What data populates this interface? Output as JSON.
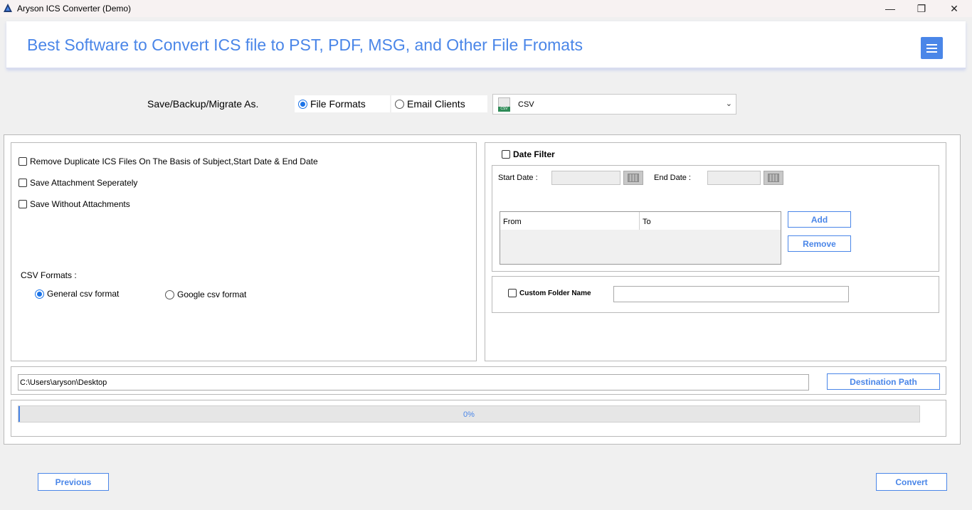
{
  "window": {
    "title": "Aryson ICS Converter (Demo)",
    "minimize_glyph": "—",
    "maximize_glyph": "❐",
    "close_glyph": "✕"
  },
  "header": {
    "title": "Best Software to Convert ICS file to PST, PDF, MSG, and Other File Fromats",
    "accent": "#4a86e8"
  },
  "save_as": {
    "label": "Save/Backup/Migrate As.",
    "options": [
      {
        "label": "File Formats",
        "selected": true
      },
      {
        "label": "Email Clients",
        "selected": false
      }
    ],
    "format_value": "CSV",
    "format_chevron": "⌄"
  },
  "options": {
    "remove_duplicates": "Remove Duplicate ICS Files On The Basis of Subject,Start Date & End Date",
    "save_attachment": "Save Attachment Seperately",
    "save_without_attachments": "Save Without Attachments"
  },
  "csv_formats": {
    "label": "CSV Formats :",
    "general": "General csv format",
    "google": "Google csv format",
    "selected": "general"
  },
  "date_filter": {
    "title": "Date Filter",
    "start_label": "Start Date :",
    "end_label": "End Date :",
    "columns": [
      "From",
      "To"
    ],
    "add_label": "Add",
    "remove_label": "Remove"
  },
  "custom_folder": {
    "label": "Custom Folder Name"
  },
  "destination": {
    "path": "C:\\Users\\aryson\\Desktop",
    "button_label": "Destination Path"
  },
  "progress": {
    "text": "0%",
    "fraction": 0.0
  },
  "footer": {
    "previous_label": "Previous",
    "convert_label": "Convert"
  }
}
